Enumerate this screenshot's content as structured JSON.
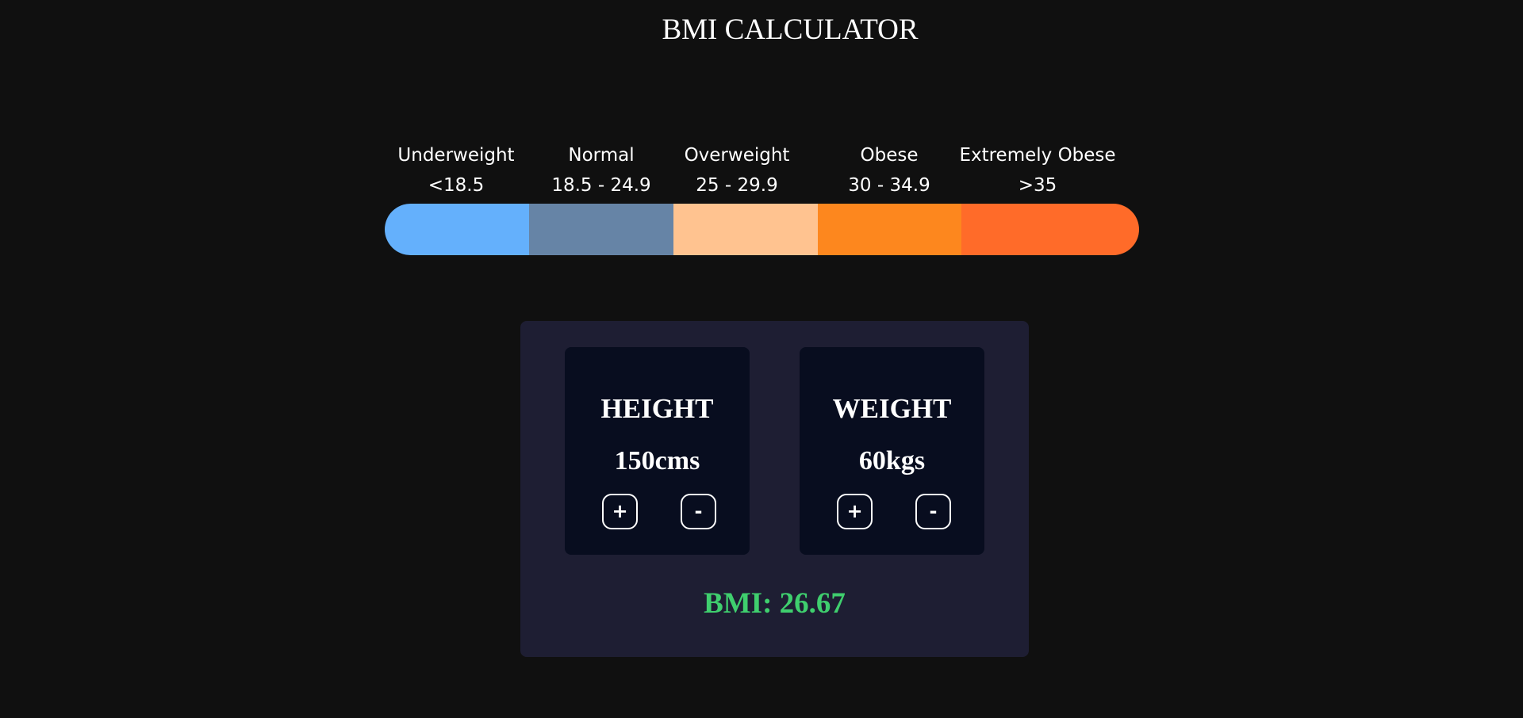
{
  "title": "BMI CALCULATOR",
  "scale": {
    "categories": [
      {
        "label": "Underweight",
        "range": "<18.5",
        "color": "#64b0fc"
      },
      {
        "label": "Normal",
        "range": "18.5 - 24.9",
        "color": "#6684a6"
      },
      {
        "label": "Overweight",
        "range": "25 - 29.9",
        "color": "#ffc390"
      },
      {
        "label": "Obese",
        "range": "30 - 34.9",
        "color": "#fd871e"
      },
      {
        "label": "Extremely Obese",
        "range": ">35",
        "color": "#ff6b29"
      }
    ]
  },
  "height": {
    "label": "HEIGHT",
    "value": "150cms",
    "plus": "+",
    "minus": "-"
  },
  "weight": {
    "label": "WEIGHT",
    "value": "60kgs",
    "plus": "+",
    "minus": "-"
  },
  "result": {
    "text": "BMI: 26.67",
    "color": "#3fcf6e"
  }
}
